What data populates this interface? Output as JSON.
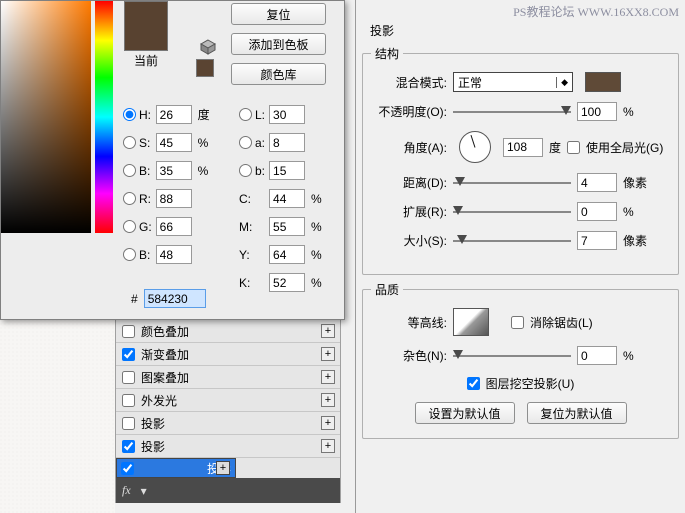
{
  "watermark": "PS教程论坛 WWW.16XX8.COM",
  "picker": {
    "current_label": "当前",
    "buttons": {
      "reset": "复位",
      "add_swatch": "添加到色板",
      "color_lib": "颜色库"
    },
    "hsb": {
      "h_label": "H:",
      "h": "26",
      "h_unit": "度",
      "s_label": "S:",
      "s": "45",
      "s_unit": "%",
      "b_label": "B:",
      "b": "35",
      "b_unit": "%"
    },
    "lab": {
      "l_label": "L:",
      "l": "30",
      "a_label": "a:",
      "a": "8",
      "b_label": "b:",
      "b": "15"
    },
    "rgb": {
      "r_label": "R:",
      "r": "88",
      "g_label": "G:",
      "g": "66",
      "b_label": "B:",
      "b": "48"
    },
    "cmyk": {
      "c_label": "C:",
      "c": "44",
      "m_label": "M:",
      "m": "55",
      "y_label": "Y:",
      "y": "64",
      "k_label": "K:",
      "k": "52",
      "unit": "%"
    },
    "hex_prefix": "#",
    "hex": "584230"
  },
  "fx": {
    "items": [
      {
        "label": "颜色叠加",
        "checked": false
      },
      {
        "label": "渐变叠加",
        "checked": true
      },
      {
        "label": "图案叠加",
        "checked": false
      },
      {
        "label": "外发光",
        "checked": false
      },
      {
        "label": "投影",
        "checked": false
      },
      {
        "label": "投影",
        "checked": true
      },
      {
        "label": "投影",
        "checked": true,
        "selected": true
      }
    ],
    "footer_fx": "fx"
  },
  "ls": {
    "title": "投影",
    "struct_legend": "结构",
    "blend_label": "混合模式:",
    "blend_value": "正常",
    "opacity_label": "不透明度(O):",
    "opacity": "100",
    "opacity_unit": "%",
    "angle_label": "角度(A):",
    "angle": "108",
    "angle_unit": "度",
    "global_label": "使用全局光(G)",
    "dist_label": "距离(D):",
    "dist": "4",
    "dist_unit": "像素",
    "spread_label": "扩展(R):",
    "spread": "0",
    "spread_unit": "%",
    "size_label": "大小(S):",
    "size": "7",
    "size_unit": "像素",
    "quality_legend": "品质",
    "contour_label": "等高线:",
    "antialias_label": "消除锯齿(L)",
    "noise_label": "杂色(N):",
    "noise": "0",
    "noise_unit": "%",
    "knockout_label": "图层挖空投影(U)",
    "set_default": "设置为默认值",
    "reset_default": "复位为默认值"
  }
}
